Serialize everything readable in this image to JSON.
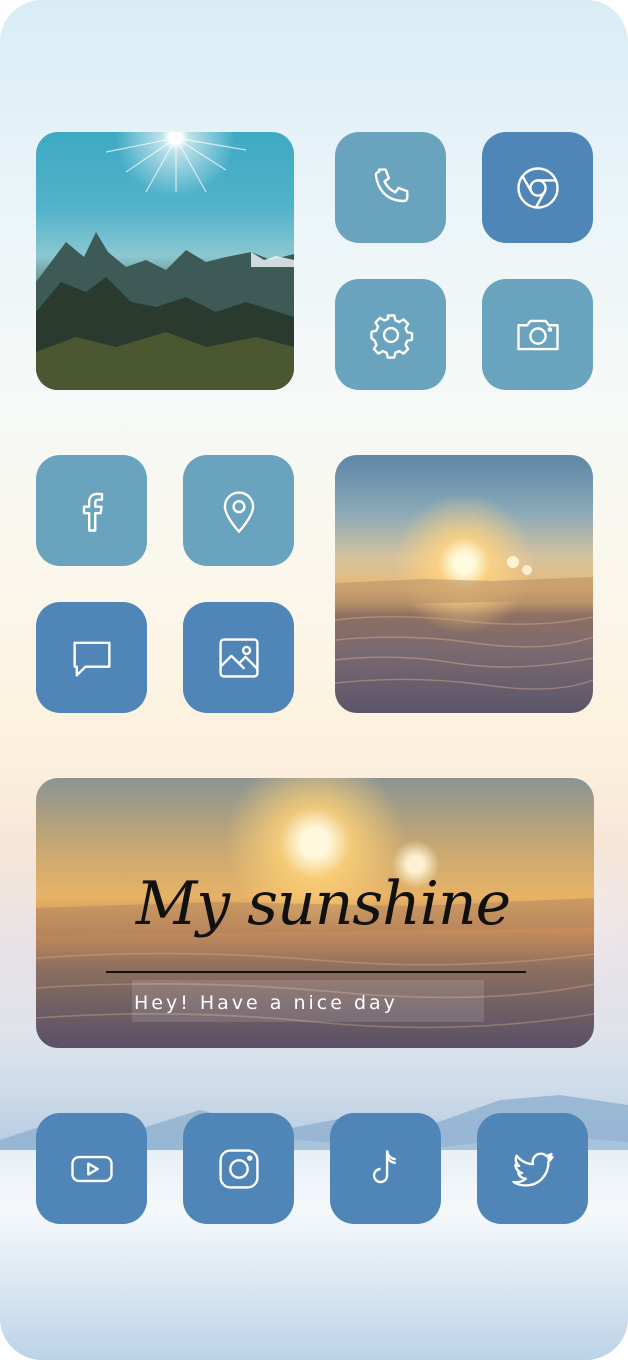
{
  "banner": {
    "title": "My sunshine",
    "subtitle": "Hey! Have a nice day"
  },
  "apps": [
    {
      "icon": "phone-icon"
    },
    {
      "icon": "chrome-icon"
    },
    {
      "icon": "settings-icon"
    },
    {
      "icon": "camera-icon"
    },
    {
      "icon": "facebook-icon"
    },
    {
      "icon": "location-pin-icon"
    },
    {
      "icon": "messages-icon"
    },
    {
      "icon": "photos-icon"
    },
    {
      "icon": "youtube-icon"
    },
    {
      "icon": "instagram-icon"
    },
    {
      "icon": "tiktok-icon"
    },
    {
      "icon": "twitter-icon"
    }
  ],
  "colors": {
    "tile_light": "#6aa3bd",
    "tile_dark": "#4f86b7",
    "icon_stroke": "#ffffff"
  }
}
